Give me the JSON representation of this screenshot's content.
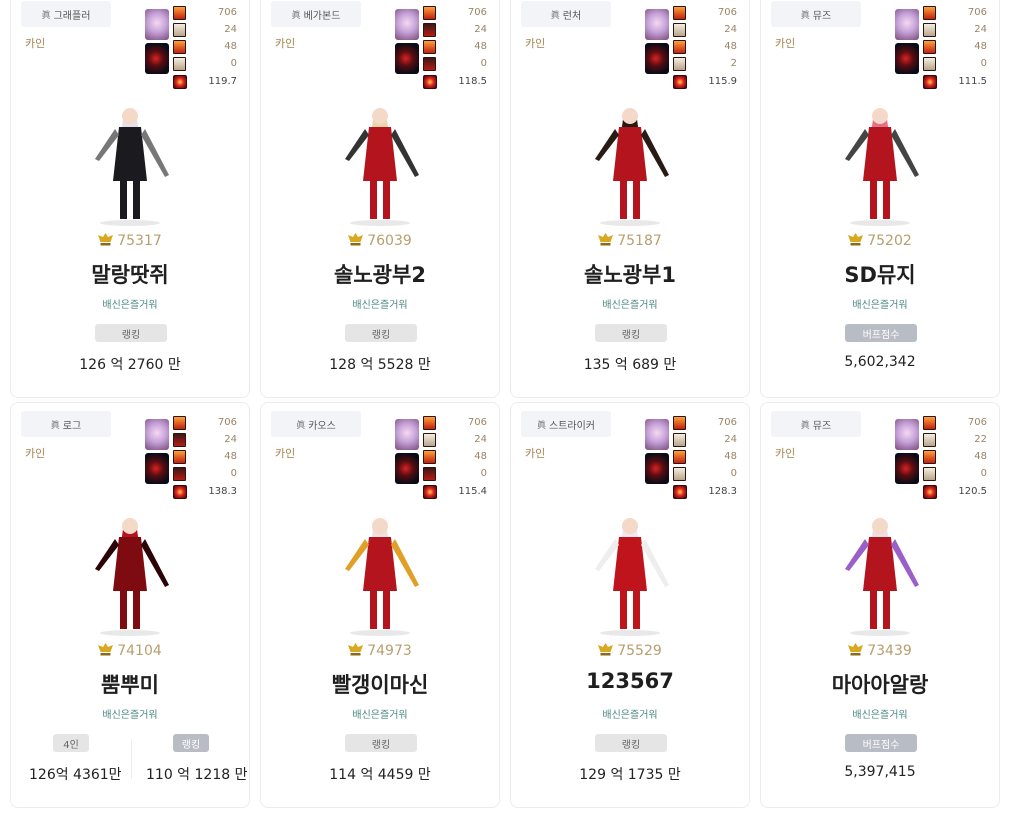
{
  "cards": [
    {
      "class": "그래플러",
      "adventure": "카인",
      "buff_values": [
        "706",
        "24",
        "48",
        "0"
      ],
      "total": "119.7",
      "rank": "75317",
      "name": "말랑땃쥐",
      "guild": "배신은즐거워",
      "pill": "랭킹",
      "score": "126 억 2760 만"
    },
    {
      "class": "베가본드",
      "adventure": "카인",
      "buff_values": [
        "706",
        "24",
        "48",
        "0"
      ],
      "total": "118.5",
      "rank": "76039",
      "name": "솔노광부2",
      "guild": "배신은즐거워",
      "pill": "랭킹",
      "score": "128 억 5528 만"
    },
    {
      "class": "런처",
      "adventure": "카인",
      "buff_values": [
        "706",
        "24",
        "48",
        "2"
      ],
      "total": "115.9",
      "rank": "75187",
      "name": "솔노광부1",
      "guild": "배신은즐거워",
      "pill": "랭킹",
      "score": "135 억 689 만"
    },
    {
      "class": "뮤즈",
      "adventure": "카인",
      "buff_values": [
        "706",
        "24",
        "48",
        "0"
      ],
      "total": "111.5",
      "rank": "75202",
      "name": "SD뮤지",
      "guild": "배신은즐거워",
      "pill": "버프점수",
      "score": "5,602,342"
    },
    {
      "class": "로그",
      "adventure": "카인",
      "buff_values": [
        "706",
        "24",
        "48",
        "0"
      ],
      "total": "138.3",
      "rank": "74104",
      "name": "뿜뿌미",
      "guild": "배신은즐거워",
      "pill_left": "4인",
      "score_left": "126억 4361만",
      "pill_right": "랭킹",
      "score_right": "110 억 1218 만"
    },
    {
      "class": "카오스",
      "adventure": "카인",
      "buff_values": [
        "706",
        "24",
        "48",
        "0"
      ],
      "total": "115.4",
      "rank": "74973",
      "name": "빨갱이마신",
      "guild": "배신은즐거워",
      "pill": "랭킹",
      "score": "114 억 4459 만"
    },
    {
      "class": "스트라이커",
      "adventure": "카인",
      "buff_values": [
        "706",
        "24",
        "48",
        "0"
      ],
      "total": "128.3",
      "rank": "75529",
      "name": "123567",
      "guild": "배신은즐거워",
      "pill": "랭킹",
      "score": "129 억 1735 만"
    },
    {
      "class": "뮤즈",
      "adventure": "카인",
      "buff_values": [
        "706",
        "22",
        "48",
        "0"
      ],
      "total": "120.5",
      "rank": "73439",
      "name": "마아아알랑",
      "guild": "배신은즐거워",
      "pill": "버프점수",
      "score": "5,397,415"
    }
  ],
  "class_mark": "眞",
  "colors": {
    "adventure": "#a3844f",
    "guild": "#4d8a84",
    "rank": "#b79f6e",
    "accent_red": "#c0210f"
  },
  "icons": {
    "rank": "rank-emblem-icon",
    "buff": "buff-chip-icon",
    "total": "total-buff-icon"
  }
}
